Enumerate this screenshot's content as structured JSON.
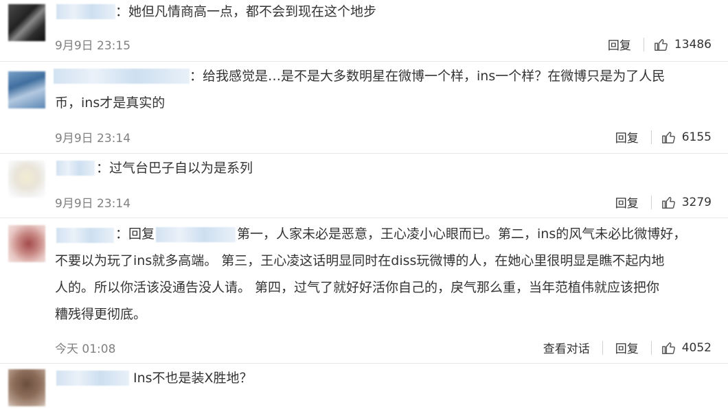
{
  "comments": [
    {
      "text_lines": [
        "：她但凡情商高一点，都不会到现在这个地步"
      ],
      "time": "9月9日 23:15",
      "reply_label": "回复",
      "likes": "13486"
    },
    {
      "text_lines": [
        "：给我感觉是…是不是大多数明星在微博一个样，ins一个样？在微博只是为了人民",
        "币，ins才是真实的"
      ],
      "time": "9月9日 23:14",
      "reply_label": "回复",
      "likes": "6155"
    },
    {
      "text_lines": [
        "：过气台巴子自以为是系列"
      ],
      "time": "9月9日 23:14",
      "reply_label": "回复",
      "likes": "3279"
    },
    {
      "text_lines": [
        "：回复",
        "第一，人家未必是恶意，王心凌小心眼而已。第二，ins的风气未必比微博好，",
        "不要以为玩了ins就多高端。 第三，王心凌这话明显同时在diss玩微博的人，在她心里很明显是瞧不起内地",
        "人的。所以你活该没通告没人请。 第四，过气了就好好活你自己的，戾气那么重，当年范植伟就应该把你",
        "糟残得更彻底。"
      ],
      "time": "今天 01:08",
      "view_conversation_label": "查看对话",
      "reply_label": "回复",
      "likes": "4052"
    },
    {
      "text_lines": [
        "Ins不也是装X胜地？"
      ]
    }
  ]
}
